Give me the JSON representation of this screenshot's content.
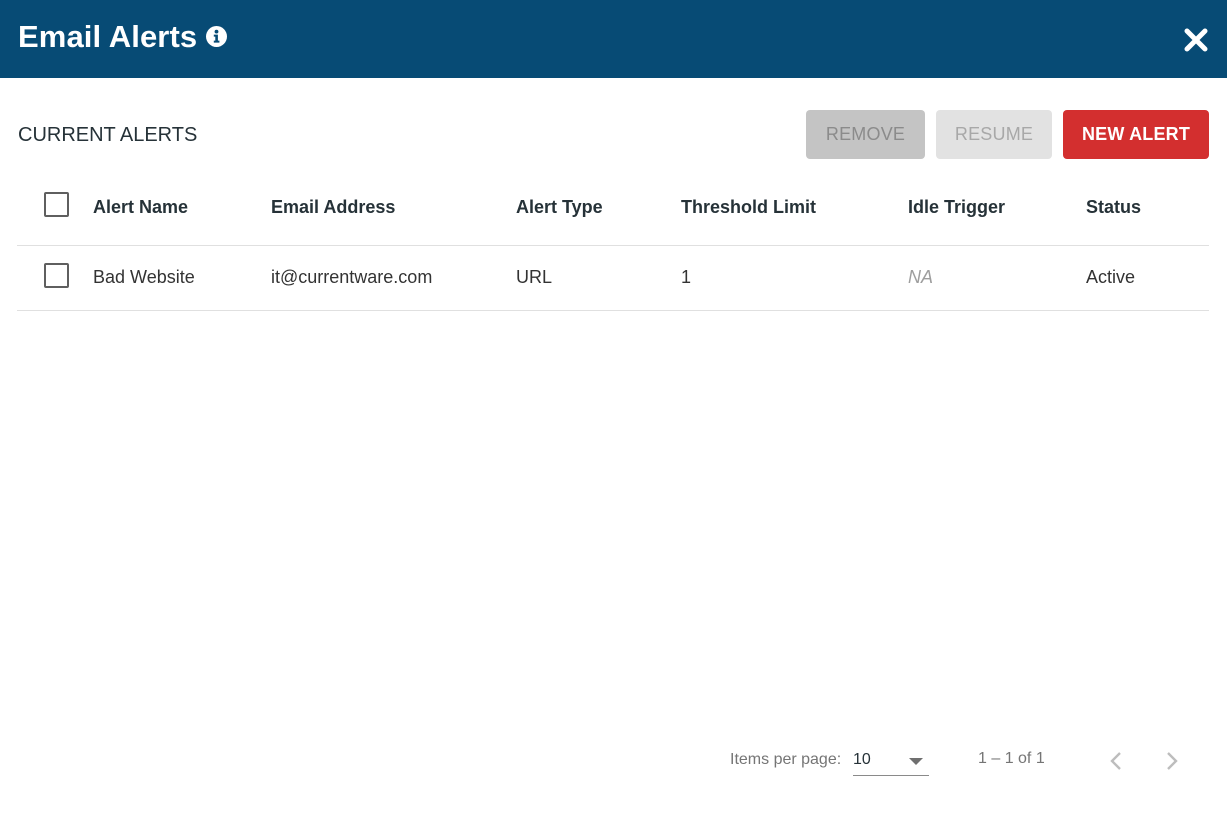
{
  "header": {
    "title": "Email Alerts",
    "info_icon": "info-circle-icon",
    "close_icon": "close-icon",
    "background_color": "#074b75"
  },
  "toolbar": {
    "section_title": "CURRENT ALERTS",
    "remove_label": "REMOVE",
    "resume_label": "RESUME",
    "new_alert_label": "NEW ALERT",
    "new_alert_color": "#d32f2f"
  },
  "table": {
    "columns": [
      "Alert Name",
      "Email Address",
      "Alert Type",
      "Threshold Limit",
      "Idle Trigger",
      "Status"
    ],
    "rows": [
      {
        "alert_name": "Bad Website",
        "email_address": "it@currentware.com",
        "alert_type": "URL",
        "threshold_limit": "1",
        "idle_trigger": "NA",
        "status": "Active"
      }
    ]
  },
  "paginator": {
    "items_per_page_label": "Items per page:",
    "items_per_page_value": "10",
    "range_label": "1 – 1 of 1",
    "prev_icon": "chevron-left-icon",
    "next_icon": "chevron-right-icon"
  }
}
